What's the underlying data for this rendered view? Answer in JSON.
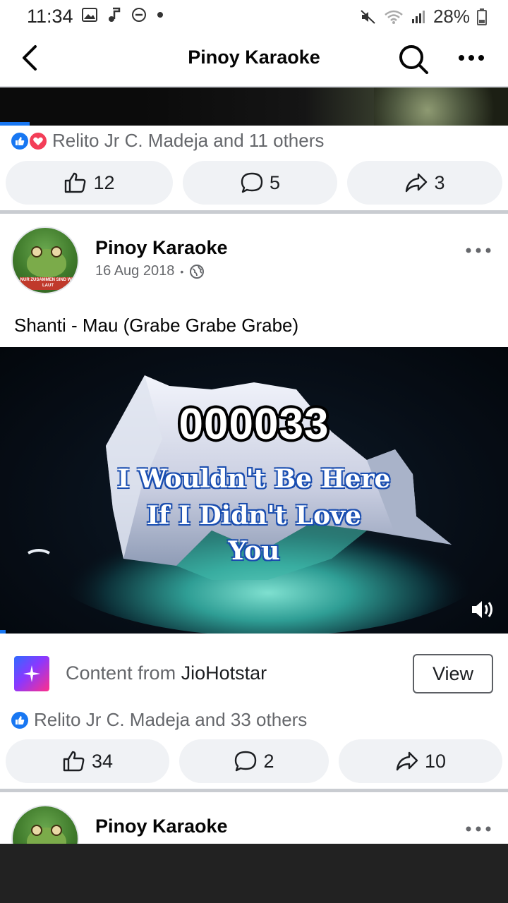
{
  "status_bar": {
    "time": "11:34",
    "battery": "28%",
    "icons": [
      "image-icon",
      "music-icon",
      "dnd-icon",
      "dot-icon",
      "mute-icon",
      "wifi-icon",
      "signal-icon",
      "battery-icon"
    ]
  },
  "app_bar": {
    "title": "Pinoy Karaoke"
  },
  "previous_post": {
    "reactions_text": "Relito Jr C. Madeja and 11 others",
    "likes": "12",
    "comments": "5",
    "shares": "3"
  },
  "post": {
    "author": "Pinoy Karaoke",
    "date": "16 Aug 2018",
    "separator": "•",
    "text": "Shanti - Mau (Grabe Grabe Grabe)",
    "avatar_banner": "NUR ZUSAMMEN SIND WIR LAUT",
    "video": {
      "counter": "000033",
      "lyrics": [
        "I Wouldn't Be Here",
        "If I Didn't Love",
        "You"
      ]
    },
    "content_from": {
      "prefix": "Content from",
      "brand": "JioHotstar",
      "view_label": "View"
    },
    "reactions_text": "Relito Jr C. Madeja and 33 others",
    "likes": "34",
    "comments": "2",
    "shares": "10"
  },
  "next_post": {
    "author": "Pinoy Karaoke"
  },
  "colors": {
    "accent": "#1877f2",
    "love": "#f33e58",
    "pill_bg": "#f0f2f5",
    "muted_text": "#65676b"
  }
}
